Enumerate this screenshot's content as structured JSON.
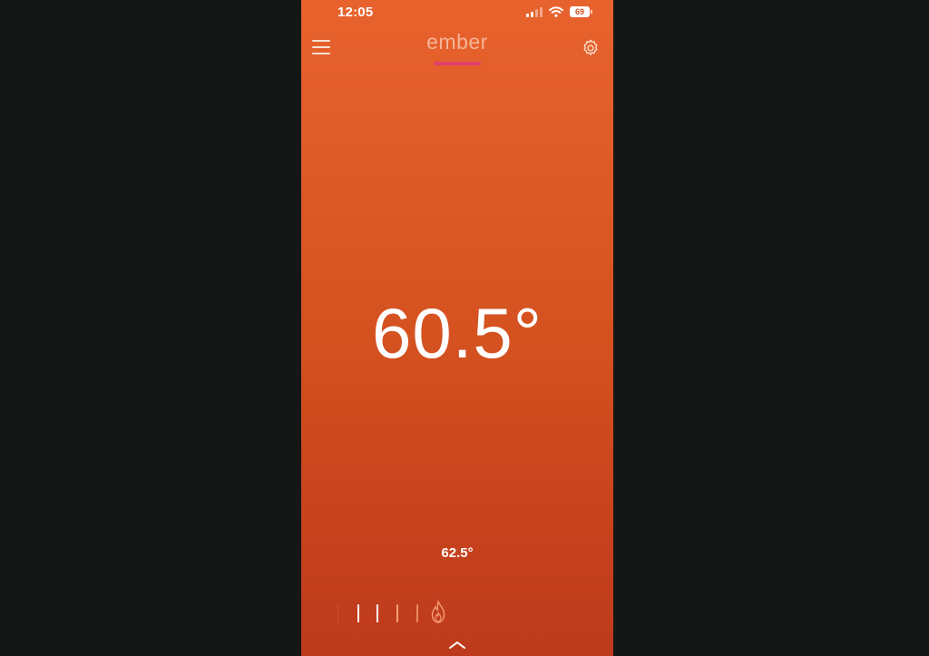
{
  "status_bar": {
    "time": "12:05",
    "battery": "69"
  },
  "header": {
    "logo_text": "ember",
    "menu_icon": "hamburger-menu-icon",
    "settings_icon": "gear-icon"
  },
  "temperature": {
    "current": "60.5°",
    "target": "62.5°"
  },
  "level_indicator": {
    "icon": "flame-icon",
    "colors": [
      "#ffffff",
      "#ffffff",
      "#f7a07a",
      "#ea8a64",
      "#ec7850"
    ]
  },
  "bottom": {
    "expand_icon": "chevron-up-icon"
  },
  "colors": {
    "background_top": "#e8622d",
    "background_bottom": "#bd3a1d",
    "logo_accent": "#e23f6d",
    "outer_background": "#151716"
  }
}
